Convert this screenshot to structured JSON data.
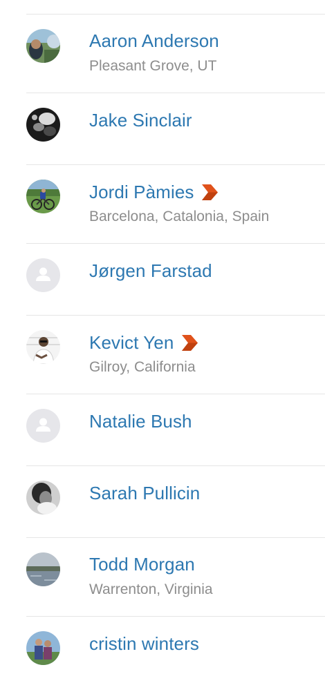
{
  "athletes": [
    {
      "name": "Aaron Anderson",
      "location": "Pleasant Grove, UT",
      "premium": false,
      "avatar": "photo-landscape-avatar"
    },
    {
      "name": "Jake Sinclair",
      "location": "",
      "premium": false,
      "avatar": "photo-bw-avatar"
    },
    {
      "name": "Jordi Pàmies",
      "location": "Barcelona, Catalonia, Spain",
      "premium": true,
      "avatar": "photo-cyclist-avatar"
    },
    {
      "name": "Jørgen Farstad",
      "location": "",
      "premium": false,
      "avatar": "default-person-avatar"
    },
    {
      "name": "Kevict Yen",
      "location": "Gilroy, California",
      "premium": true,
      "avatar": "photo-person-avatar"
    },
    {
      "name": "Natalie Bush",
      "location": "",
      "premium": false,
      "avatar": "default-person-avatar"
    },
    {
      "name": "Sarah Pullicin",
      "location": "",
      "premium": false,
      "avatar": "photo-bw-portrait-avatar"
    },
    {
      "name": "Todd Morgan",
      "location": "Warrenton, Virginia",
      "premium": false,
      "avatar": "photo-lake-avatar"
    },
    {
      "name": "cristin winters",
      "location": "",
      "premium": false,
      "avatar": "photo-couple-avatar"
    }
  ],
  "colors": {
    "name": "#2d78b1",
    "location": "#8d8d8d",
    "divider": "#e5e5e5",
    "premium_badge": "#e0521b",
    "default_avatar_bg": "#e6e6ea"
  },
  "icons": {
    "premium": "premium-chevron-icon",
    "default_avatar": "person-silhouette-icon"
  }
}
